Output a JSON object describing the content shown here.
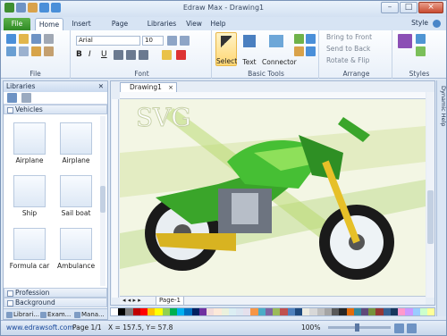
{
  "window": {
    "title": "Edraw Max - Drawing1"
  },
  "tabs": [
    "File",
    "Home",
    "Insert",
    "Page Layout",
    "Libraries",
    "View",
    "Help"
  ],
  "style_menu": "Style",
  "ribbon": {
    "groups": {
      "file": "File",
      "font": "Font",
      "basic_tools": "Basic Tools",
      "arrange": "Arrange",
      "styles": "Styles"
    },
    "font_name": "Arial",
    "font_size": "10",
    "select": "Select",
    "text": "Text",
    "connector": "Connector",
    "bring_to_front": "Bring to Front",
    "send_to_back": "Send to Back",
    "rotate_flip": "Rotate & Flip"
  },
  "libraries": {
    "title": "Libraries",
    "sections": {
      "vehicles": "Vehicles",
      "profession": "Profession",
      "background": "Background"
    },
    "shapes": [
      "Airplane",
      "Airplane",
      "Ship",
      "Sail boat",
      "Formula car",
      "Ambulance"
    ],
    "bottom_tabs": [
      "Librari...",
      "Exam...",
      "Mana..."
    ]
  },
  "document": {
    "tab": "Drawing1",
    "page_tab": "Page-1",
    "svg_label": "SVG"
  },
  "right_panel": "Dynamic Help",
  "status": {
    "url": "www.edrawsoft.com",
    "page": "Page 1/1",
    "coords": "X = 157.5, Y= 57.8",
    "zoom": "100%"
  },
  "colors": {
    "accent": "#2f8a25",
    "palette": [
      "#ffffff",
      "#000000",
      "#7f7f7f",
      "#c00000",
      "#ff0000",
      "#ffc000",
      "#ffff00",
      "#92d050",
      "#00b050",
      "#00b0f0",
      "#0070c0",
      "#002060",
      "#7030a0",
      "#f2dcdb",
      "#fde9d9",
      "#ebf1dd",
      "#dbeef3",
      "#dce6f1",
      "#e5e0ec",
      "#f79646",
      "#4bacc6",
      "#8064a2",
      "#9bbb59",
      "#c0504d",
      "#4f81bd",
      "#1f497d",
      "#eeece1",
      "#d8d8d8",
      "#bfbfbf",
      "#a5a5a5",
      "#595959",
      "#262626",
      "#e26b0a",
      "#31869b",
      "#60497a",
      "#76923c",
      "#953735",
      "#366092",
      "#17375d",
      "#ff99cc",
      "#cc99ff",
      "#99ccff",
      "#ccffcc",
      "#ffff99"
    ]
  }
}
